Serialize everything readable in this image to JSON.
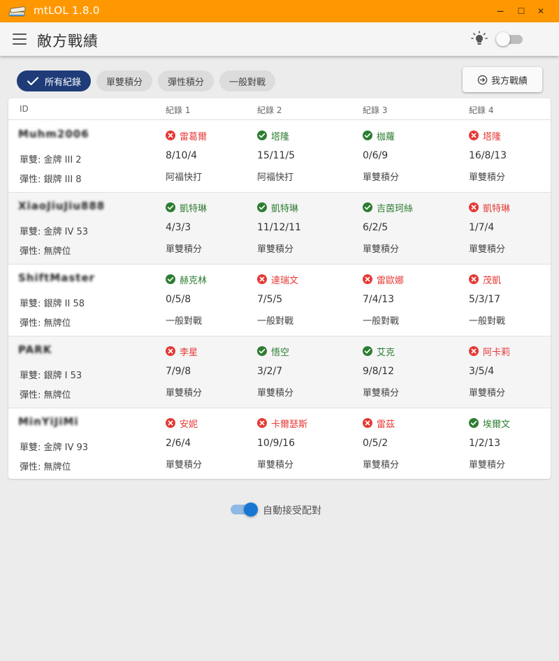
{
  "window": {
    "title": "mtLOL 1.8.0",
    "minimize_glyph": "—",
    "maximize_glyph": "☐",
    "close_glyph": "✕"
  },
  "header": {
    "title": "敵方戰績",
    "theme_dark_enabled": false
  },
  "filters": {
    "chips": [
      {
        "label": "所有紀錄",
        "active": true
      },
      {
        "label": "單雙積分",
        "active": false
      },
      {
        "label": "彈性積分",
        "active": false
      },
      {
        "label": "一般對戰",
        "active": false
      }
    ],
    "our_button_label": "我方戰績"
  },
  "table": {
    "columns": [
      "ID",
      "紀錄 1",
      "紀錄 2",
      "紀錄 3",
      "紀錄 4"
    ],
    "rows": [
      {
        "name": "Muhm2006",
        "solo": "單雙: 金牌 III 2",
        "flex": "彈性: 銀牌 III 8",
        "records": [
          {
            "champion": "雷葛爾",
            "win": false,
            "kda": "8/10/4",
            "mode": "阿福快打"
          },
          {
            "champion": "塔隆",
            "win": true,
            "kda": "15/11/5",
            "mode": "阿福快打"
          },
          {
            "champion": "枷蘿",
            "win": true,
            "kda": "0/6/9",
            "mode": "單雙積分"
          },
          {
            "champion": "塔隆",
            "win": false,
            "kda": "16/8/13",
            "mode": "單雙積分"
          }
        ]
      },
      {
        "name": "XiaoJiuJiu888",
        "solo": "單雙: 金牌 IV 53",
        "flex": "彈性: 無牌位",
        "records": [
          {
            "champion": "凱特琳",
            "win": true,
            "kda": "4/3/3",
            "mode": "單雙積分"
          },
          {
            "champion": "凱特琳",
            "win": true,
            "kda": "11/12/11",
            "mode": "單雙積分"
          },
          {
            "champion": "吉茵珂絲",
            "win": true,
            "kda": "6/2/5",
            "mode": "單雙積分"
          },
          {
            "champion": "凱特琳",
            "win": false,
            "kda": "1/7/4",
            "mode": "單雙積分"
          }
        ]
      },
      {
        "name": "ShiftMaster",
        "solo": "單雙: 銀牌 II 58",
        "flex": "彈性: 無牌位",
        "records": [
          {
            "champion": "赫克林",
            "win": true,
            "kda": "0/5/8",
            "mode": "一般對戰"
          },
          {
            "champion": "達瑞文",
            "win": false,
            "kda": "7/5/5",
            "mode": "一般對戰"
          },
          {
            "champion": "雷歐娜",
            "win": false,
            "kda": "7/4/13",
            "mode": "一般對戰"
          },
          {
            "champion": "茂凱",
            "win": false,
            "kda": "5/3/17",
            "mode": "一般對戰"
          }
        ]
      },
      {
        "name": "PARK",
        "solo": "單雙: 銀牌 I 53",
        "flex": "彈性: 無牌位",
        "records": [
          {
            "champion": "李星",
            "win": false,
            "kda": "7/9/8",
            "mode": "單雙積分"
          },
          {
            "champion": "悟空",
            "win": true,
            "kda": "3/2/7",
            "mode": "單雙積分"
          },
          {
            "champion": "艾克",
            "win": true,
            "kda": "9/8/12",
            "mode": "單雙積分"
          },
          {
            "champion": "阿卡莉",
            "win": false,
            "kda": "3/5/4",
            "mode": "單雙積分"
          }
        ]
      },
      {
        "name": "MinYiJiMi",
        "solo": "單雙: 金牌 IV 93",
        "flex": "彈性: 無牌位",
        "records": [
          {
            "champion": "安妮",
            "win": false,
            "kda": "2/6/4",
            "mode": "單雙積分"
          },
          {
            "champion": "卡爾瑟斯",
            "win": false,
            "kda": "10/9/16",
            "mode": "單雙積分"
          },
          {
            "champion": "雷茲",
            "win": false,
            "kda": "0/5/2",
            "mode": "單雙積分"
          },
          {
            "champion": "埃爾文",
            "win": true,
            "kda": "1/2/13",
            "mode": "單雙積分"
          }
        ]
      }
    ]
  },
  "auto_accept": {
    "label": "自動接受配對",
    "enabled": true
  },
  "colors": {
    "titlebar": "#ff9800",
    "active_chip": "#1f3c78",
    "win": "#2e7d32",
    "loss": "#e53935",
    "switch_on": "#1976d2"
  },
  "icons": {
    "app": "book-stack-icon",
    "menu": "hamburger-menu-icon",
    "light": "lightbulb-icon",
    "dark": "moon-icon",
    "chip_check": "check-icon",
    "our_button": "swap-circle-icon",
    "win": "check-circle-icon",
    "loss": "x-circle-icon"
  }
}
